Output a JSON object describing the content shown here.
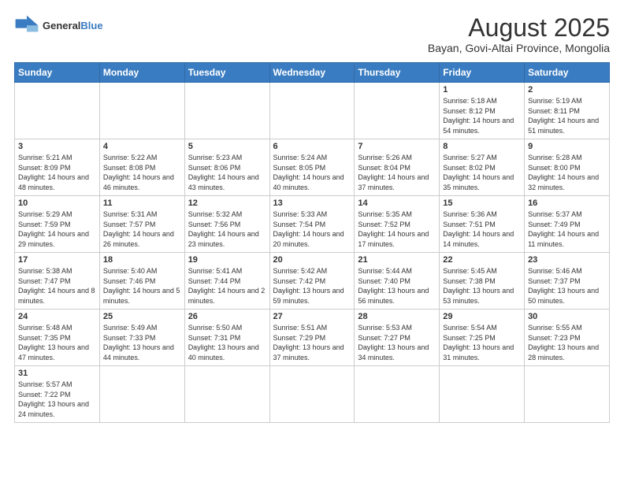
{
  "header": {
    "logo_line1": "General",
    "logo_line2": "Blue",
    "main_title": "August 2025",
    "subtitle": "Bayan, Govi-Altai Province, Mongolia"
  },
  "weekdays": [
    "Sunday",
    "Monday",
    "Tuesday",
    "Wednesday",
    "Thursday",
    "Friday",
    "Saturday"
  ],
  "weeks": [
    [
      {
        "day": "",
        "info": ""
      },
      {
        "day": "",
        "info": ""
      },
      {
        "day": "",
        "info": ""
      },
      {
        "day": "",
        "info": ""
      },
      {
        "day": "",
        "info": ""
      },
      {
        "day": "1",
        "info": "Sunrise: 5:18 AM\nSunset: 8:12 PM\nDaylight: 14 hours and 54 minutes."
      },
      {
        "day": "2",
        "info": "Sunrise: 5:19 AM\nSunset: 8:11 PM\nDaylight: 14 hours and 51 minutes."
      }
    ],
    [
      {
        "day": "3",
        "info": "Sunrise: 5:21 AM\nSunset: 8:09 PM\nDaylight: 14 hours and 48 minutes."
      },
      {
        "day": "4",
        "info": "Sunrise: 5:22 AM\nSunset: 8:08 PM\nDaylight: 14 hours and 46 minutes."
      },
      {
        "day": "5",
        "info": "Sunrise: 5:23 AM\nSunset: 8:06 PM\nDaylight: 14 hours and 43 minutes."
      },
      {
        "day": "6",
        "info": "Sunrise: 5:24 AM\nSunset: 8:05 PM\nDaylight: 14 hours and 40 minutes."
      },
      {
        "day": "7",
        "info": "Sunrise: 5:26 AM\nSunset: 8:04 PM\nDaylight: 14 hours and 37 minutes."
      },
      {
        "day": "8",
        "info": "Sunrise: 5:27 AM\nSunset: 8:02 PM\nDaylight: 14 hours and 35 minutes."
      },
      {
        "day": "9",
        "info": "Sunrise: 5:28 AM\nSunset: 8:00 PM\nDaylight: 14 hours and 32 minutes."
      }
    ],
    [
      {
        "day": "10",
        "info": "Sunrise: 5:29 AM\nSunset: 7:59 PM\nDaylight: 14 hours and 29 minutes."
      },
      {
        "day": "11",
        "info": "Sunrise: 5:31 AM\nSunset: 7:57 PM\nDaylight: 14 hours and 26 minutes."
      },
      {
        "day": "12",
        "info": "Sunrise: 5:32 AM\nSunset: 7:56 PM\nDaylight: 14 hours and 23 minutes."
      },
      {
        "day": "13",
        "info": "Sunrise: 5:33 AM\nSunset: 7:54 PM\nDaylight: 14 hours and 20 minutes."
      },
      {
        "day": "14",
        "info": "Sunrise: 5:35 AM\nSunset: 7:52 PM\nDaylight: 14 hours and 17 minutes."
      },
      {
        "day": "15",
        "info": "Sunrise: 5:36 AM\nSunset: 7:51 PM\nDaylight: 14 hours and 14 minutes."
      },
      {
        "day": "16",
        "info": "Sunrise: 5:37 AM\nSunset: 7:49 PM\nDaylight: 14 hours and 11 minutes."
      }
    ],
    [
      {
        "day": "17",
        "info": "Sunrise: 5:38 AM\nSunset: 7:47 PM\nDaylight: 14 hours and 8 minutes."
      },
      {
        "day": "18",
        "info": "Sunrise: 5:40 AM\nSunset: 7:46 PM\nDaylight: 14 hours and 5 minutes."
      },
      {
        "day": "19",
        "info": "Sunrise: 5:41 AM\nSunset: 7:44 PM\nDaylight: 14 hours and 2 minutes."
      },
      {
        "day": "20",
        "info": "Sunrise: 5:42 AM\nSunset: 7:42 PM\nDaylight: 13 hours and 59 minutes."
      },
      {
        "day": "21",
        "info": "Sunrise: 5:44 AM\nSunset: 7:40 PM\nDaylight: 13 hours and 56 minutes."
      },
      {
        "day": "22",
        "info": "Sunrise: 5:45 AM\nSunset: 7:38 PM\nDaylight: 13 hours and 53 minutes."
      },
      {
        "day": "23",
        "info": "Sunrise: 5:46 AM\nSunset: 7:37 PM\nDaylight: 13 hours and 50 minutes."
      }
    ],
    [
      {
        "day": "24",
        "info": "Sunrise: 5:48 AM\nSunset: 7:35 PM\nDaylight: 13 hours and 47 minutes."
      },
      {
        "day": "25",
        "info": "Sunrise: 5:49 AM\nSunset: 7:33 PM\nDaylight: 13 hours and 44 minutes."
      },
      {
        "day": "26",
        "info": "Sunrise: 5:50 AM\nSunset: 7:31 PM\nDaylight: 13 hours and 40 minutes."
      },
      {
        "day": "27",
        "info": "Sunrise: 5:51 AM\nSunset: 7:29 PM\nDaylight: 13 hours and 37 minutes."
      },
      {
        "day": "28",
        "info": "Sunrise: 5:53 AM\nSunset: 7:27 PM\nDaylight: 13 hours and 34 minutes."
      },
      {
        "day": "29",
        "info": "Sunrise: 5:54 AM\nSunset: 7:25 PM\nDaylight: 13 hours and 31 minutes."
      },
      {
        "day": "30",
        "info": "Sunrise: 5:55 AM\nSunset: 7:23 PM\nDaylight: 13 hours and 28 minutes."
      }
    ],
    [
      {
        "day": "31",
        "info": "Sunrise: 5:57 AM\nSunset: 7:22 PM\nDaylight: 13 hours and 24 minutes."
      },
      {
        "day": "",
        "info": ""
      },
      {
        "day": "",
        "info": ""
      },
      {
        "day": "",
        "info": ""
      },
      {
        "day": "",
        "info": ""
      },
      {
        "day": "",
        "info": ""
      },
      {
        "day": "",
        "info": ""
      }
    ]
  ]
}
